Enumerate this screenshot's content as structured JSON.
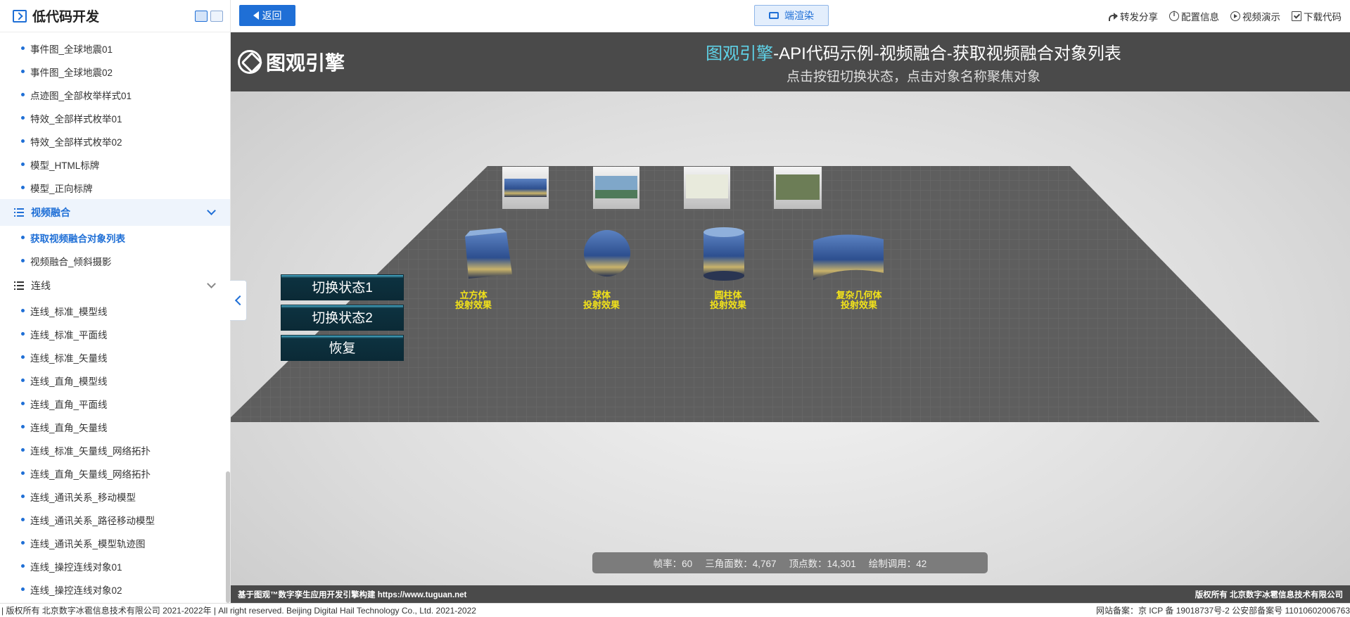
{
  "sidebar": {
    "title": "低代码开发",
    "items_top": [
      "事件图_全球地震01",
      "事件图_全球地震02",
      "点迹图_全部枚举样式01",
      "特效_全部样式枚举01",
      "特效_全部样式枚举02",
      "模型_HTML标牌",
      "模型_正向标牌"
    ],
    "group_video": "视频融合",
    "items_video": [
      "获取视频融合对象列表",
      "视频融合_倾斜摄影"
    ],
    "group_line": "连线",
    "items_line": [
      "连线_标准_模型线",
      "连线_标准_平面线",
      "连线_标准_矢量线",
      "连线_直角_模型线",
      "连线_直角_平面线",
      "连线_直角_矢量线",
      "连线_标准_矢量线_网络拓扑",
      "连线_直角_矢量线_网络拓扑",
      "连线_通讯关系_移动模型",
      "连线_通讯关系_路径移动模型",
      "连线_通讯关系_模型轨迹图",
      "连线_操控连线对象01",
      "连线_操控连线对象02"
    ]
  },
  "topbar": {
    "back_label": "返回",
    "render_label": "端渲染",
    "actions": [
      "转发分享",
      "配置信息",
      "视频演示",
      "下载代码"
    ]
  },
  "viewport": {
    "logo_text": "图观引擎",
    "title_brand": "图观引擎",
    "title_rest": "-API代码示例-视频融合-获取视频融合对象列表",
    "subtitle": "点击按钮切换状态，点击对象名称聚焦对象",
    "buttons": [
      "切换状态1",
      "切换状态2",
      "恢复"
    ],
    "objects": [
      {
        "line1": "立方体",
        "line2": "投射效果"
      },
      {
        "line1": "球体",
        "line2": "投射效果"
      },
      {
        "line1": "圆柱体",
        "line2": "投射效果"
      },
      {
        "line1": "复杂几何体",
        "line2": "投射效果"
      }
    ],
    "stats": {
      "fps": "帧率：60",
      "triangles": "三角面数：4,767",
      "vertices": "顶点数：14,301",
      "drawcalls": "绘制调用：42"
    },
    "footer_left": "基于图观™数字孪生应用开发引擎构建 https://www.tuguan.net",
    "footer_right": "版权所有 北京数字冰雹信息技术有限公司"
  },
  "page_footer": {
    "left": "| 版权所有 北京数字冰雹信息技术有限公司 2021-2022年 | All right reserved. Beijing Digital Hail Technology Co., Ltd. 2021-2022",
    "right": "网站备案：京 ICP 备 19018737号-2 公安部备案号 11010602006763"
  },
  "colors": {
    "accent": "#1f6fd6",
    "brand_cyan": "#5fd3e8",
    "label_yellow": "#f2e21a",
    "button_dark": "#0b2a36"
  }
}
